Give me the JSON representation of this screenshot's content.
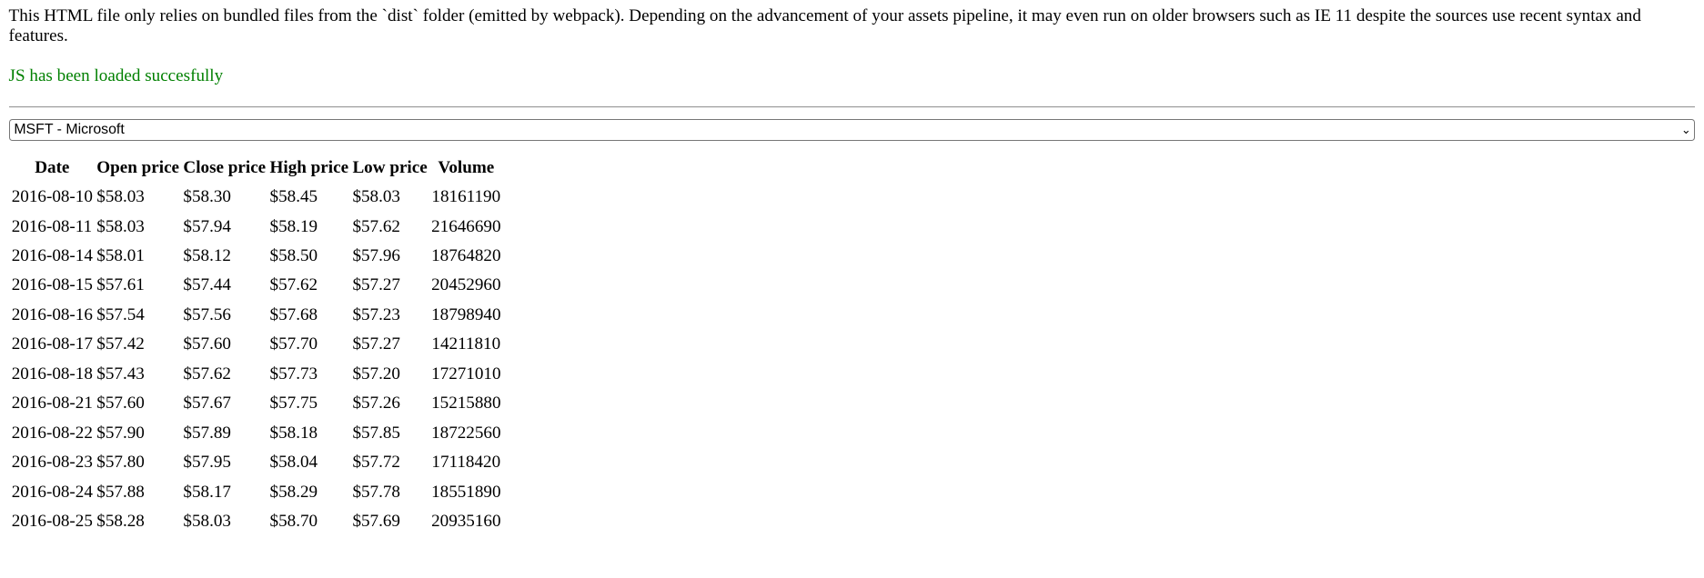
{
  "intro": "This HTML file only relies on bundled files from the `dist` folder (emitted by webpack). Depending on the advancement of your assets pipeline, it may even run on older browsers such as IE 11 despite the sources use recent syntax and features.",
  "status": "JS has been loaded succesfully",
  "status_color": "#008000",
  "stock_select": {
    "selected": "MSFT - Microsoft"
  },
  "table": {
    "headers": [
      "Date",
      "Open price",
      "Close price",
      "High price",
      "Low price",
      "Volume"
    ],
    "rows": [
      [
        "2016-08-10",
        "$58.03",
        "$58.30",
        "$58.45",
        "$58.03",
        "18161190"
      ],
      [
        "2016-08-11",
        "$58.03",
        "$57.94",
        "$58.19",
        "$57.62",
        "21646690"
      ],
      [
        "2016-08-14",
        "$58.01",
        "$58.12",
        "$58.50",
        "$57.96",
        "18764820"
      ],
      [
        "2016-08-15",
        "$57.61",
        "$57.44",
        "$57.62",
        "$57.27",
        "20452960"
      ],
      [
        "2016-08-16",
        "$57.54",
        "$57.56",
        "$57.68",
        "$57.23",
        "18798940"
      ],
      [
        "2016-08-17",
        "$57.42",
        "$57.60",
        "$57.70",
        "$57.27",
        "14211810"
      ],
      [
        "2016-08-18",
        "$57.43",
        "$57.62",
        "$57.73",
        "$57.20",
        "17271010"
      ],
      [
        "2016-08-21",
        "$57.60",
        "$57.67",
        "$57.75",
        "$57.26",
        "15215880"
      ],
      [
        "2016-08-22",
        "$57.90",
        "$57.89",
        "$58.18",
        "$57.85",
        "18722560"
      ],
      [
        "2016-08-23",
        "$57.80",
        "$57.95",
        "$58.04",
        "$57.72",
        "17118420"
      ],
      [
        "2016-08-24",
        "$57.88",
        "$58.17",
        "$58.29",
        "$57.78",
        "18551890"
      ],
      [
        "2016-08-25",
        "$58.28",
        "$58.03",
        "$58.70",
        "$57.69",
        "20935160"
      ]
    ]
  }
}
